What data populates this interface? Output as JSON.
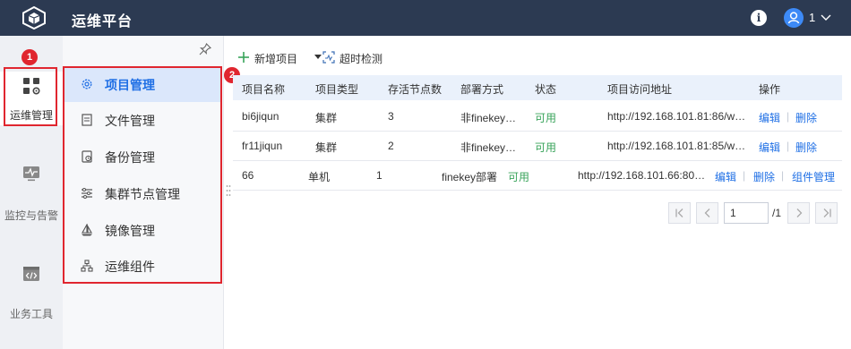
{
  "app": {
    "title": "运维平台"
  },
  "header": {
    "user_name": "1"
  },
  "rail": {
    "items": [
      {
        "label": "运维管理"
      },
      {
        "label": "监控与告警"
      },
      {
        "label": "业务工具"
      }
    ]
  },
  "subnav": {
    "items": [
      {
        "label": "项目管理",
        "active": true
      },
      {
        "label": "文件管理"
      },
      {
        "label": "备份管理"
      },
      {
        "label": "集群节点管理"
      },
      {
        "label": "镜像管理"
      },
      {
        "label": "运维组件"
      }
    ]
  },
  "annotations": {
    "badge1": "1",
    "badge2": "2"
  },
  "toolbar": {
    "add_label": "新增项目",
    "timeout_label": "超时检测"
  },
  "table": {
    "headers": [
      "项目名称",
      "项目类型",
      "存活节点数",
      "部署方式",
      "状态",
      "项目访问地址",
      "操作"
    ],
    "rows": [
      {
        "name": "bi6jiqun",
        "type": "集群",
        "alive": "3",
        "deploy": "非finekey…",
        "status": "可用",
        "url": "http://192.168.101.81:86/w…",
        "edit": "编辑",
        "delete": "删除"
      },
      {
        "name": "fr11jiqun",
        "type": "集群",
        "alive": "2",
        "deploy": "非finekey…",
        "status": "可用",
        "url": "http://192.168.101.81:85/w…",
        "edit": "编辑",
        "delete": "删除"
      },
      {
        "name": "66",
        "type": "单机",
        "alive": "1",
        "deploy": "finekey部署",
        "status": "可用",
        "url": "http://192.168.101.66:80…",
        "edit": "编辑",
        "delete": "删除",
        "component": "组件管理"
      }
    ],
    "separator": "|"
  },
  "pagination": {
    "page": "1",
    "total": "/1"
  },
  "colors": {
    "topbar": "#2c3a52",
    "accent": "#1f6fe5",
    "ok": "#38a35a",
    "annotation": "#e0262f"
  }
}
